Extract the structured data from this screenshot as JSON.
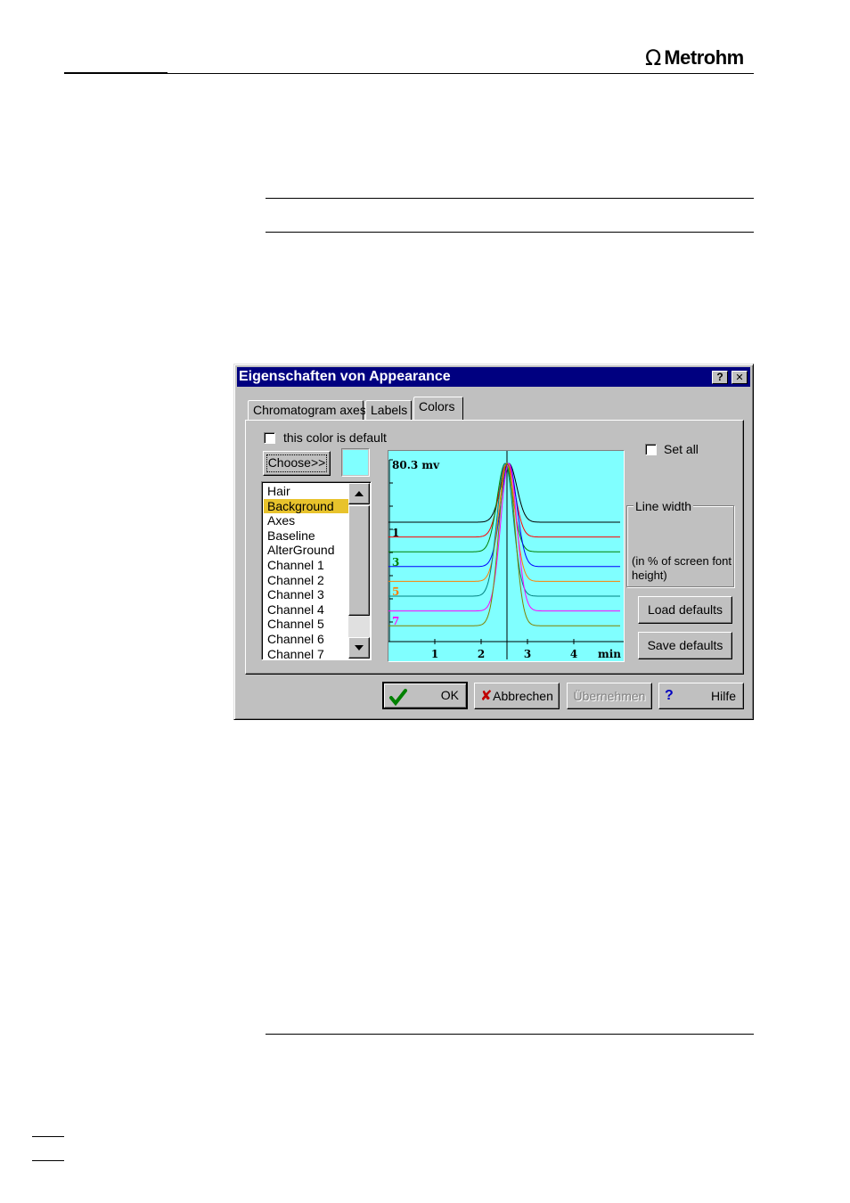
{
  "brand": {
    "name": "Metrohm",
    "symbol": "Ω"
  },
  "dialog": {
    "title": "Eigenschaften von Appearance",
    "help_btn": "?",
    "close_btn": "✕",
    "tabs": [
      {
        "label": "Chromatogram axes",
        "active": false
      },
      {
        "label": "Labels",
        "active": false
      },
      {
        "label": "Colors",
        "active": true
      }
    ],
    "default_checkbox": {
      "label": "this color is default",
      "checked": false
    },
    "choose_button": "Choose>>",
    "swatch_color": "#80ffff",
    "list": {
      "items": [
        "Hair",
        "Background",
        "Axes",
        "Baseline",
        "AlterGround",
        "Channel 1",
        "Channel 2",
        "Channel 3",
        "Channel 4",
        "Channel 5",
        "Channel 6",
        "Channel 7"
      ],
      "selected": "Background"
    },
    "preview": {
      "ylabel": "80.3 mv",
      "xlabel": "min",
      "xticks": [
        "1",
        "2",
        "3",
        "4"
      ],
      "channel_labels": [
        {
          "text": "1",
          "color": "#000000"
        },
        {
          "text": "3",
          "color": "#008000"
        },
        {
          "text": "5",
          "color": "#ff8000"
        },
        {
          "text": "7",
          "color": "#ff00ff"
        }
      ],
      "background": "#80ffff",
      "channel_colors": [
        "#000000",
        "#ff0000",
        "#008000",
        "#0000ff",
        "#ff8000",
        "#008080",
        "#ff00ff",
        "#808000"
      ]
    },
    "set_all": {
      "label": "Set all",
      "checked": false
    },
    "line_width": {
      "legend": "Line width",
      "note": "(in % of screen font height)"
    },
    "load_defaults": "Load defaults",
    "save_defaults": "Save defaults",
    "footer": {
      "ok": "OK",
      "cancel": "Abbrechen",
      "apply": "Übernehmen",
      "help": "Hilfe"
    }
  }
}
